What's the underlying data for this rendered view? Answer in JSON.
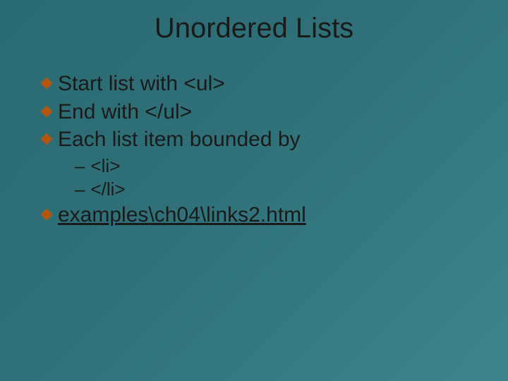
{
  "title": "Unordered Lists",
  "bullets": {
    "b1": "Start list with <ul>",
    "b2": "End with </ul>",
    "b3": "Each list item bounded by",
    "b4": "examples\\ch04\\links2.html"
  },
  "subs": {
    "s1": "<li>",
    "s2": "</li>"
  },
  "dash": "–"
}
